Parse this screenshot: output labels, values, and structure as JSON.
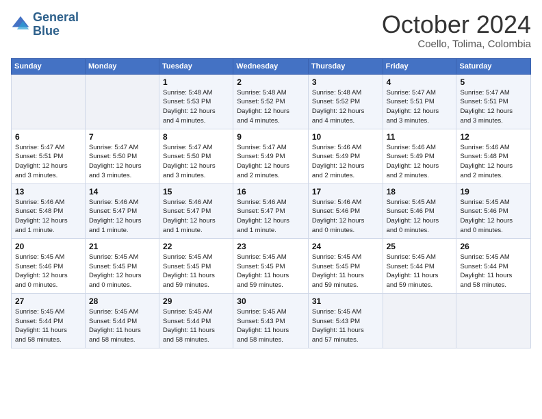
{
  "logo": {
    "line1": "General",
    "line2": "Blue"
  },
  "header": {
    "month": "October 2024",
    "location": "Coello, Tolima, Colombia"
  },
  "days_of_week": [
    "Sunday",
    "Monday",
    "Tuesday",
    "Wednesday",
    "Thursday",
    "Friday",
    "Saturday"
  ],
  "weeks": [
    [
      {
        "day": "",
        "info": ""
      },
      {
        "day": "",
        "info": ""
      },
      {
        "day": "1",
        "info": "Sunrise: 5:48 AM\nSunset: 5:53 PM\nDaylight: 12 hours\nand 4 minutes."
      },
      {
        "day": "2",
        "info": "Sunrise: 5:48 AM\nSunset: 5:52 PM\nDaylight: 12 hours\nand 4 minutes."
      },
      {
        "day": "3",
        "info": "Sunrise: 5:48 AM\nSunset: 5:52 PM\nDaylight: 12 hours\nand 4 minutes."
      },
      {
        "day": "4",
        "info": "Sunrise: 5:47 AM\nSunset: 5:51 PM\nDaylight: 12 hours\nand 3 minutes."
      },
      {
        "day": "5",
        "info": "Sunrise: 5:47 AM\nSunset: 5:51 PM\nDaylight: 12 hours\nand 3 minutes."
      }
    ],
    [
      {
        "day": "6",
        "info": "Sunrise: 5:47 AM\nSunset: 5:51 PM\nDaylight: 12 hours\nand 3 minutes."
      },
      {
        "day": "7",
        "info": "Sunrise: 5:47 AM\nSunset: 5:50 PM\nDaylight: 12 hours\nand 3 minutes."
      },
      {
        "day": "8",
        "info": "Sunrise: 5:47 AM\nSunset: 5:50 PM\nDaylight: 12 hours\nand 3 minutes."
      },
      {
        "day": "9",
        "info": "Sunrise: 5:47 AM\nSunset: 5:49 PM\nDaylight: 12 hours\nand 2 minutes."
      },
      {
        "day": "10",
        "info": "Sunrise: 5:46 AM\nSunset: 5:49 PM\nDaylight: 12 hours\nand 2 minutes."
      },
      {
        "day": "11",
        "info": "Sunrise: 5:46 AM\nSunset: 5:49 PM\nDaylight: 12 hours\nand 2 minutes."
      },
      {
        "day": "12",
        "info": "Sunrise: 5:46 AM\nSunset: 5:48 PM\nDaylight: 12 hours\nand 2 minutes."
      }
    ],
    [
      {
        "day": "13",
        "info": "Sunrise: 5:46 AM\nSunset: 5:48 PM\nDaylight: 12 hours\nand 1 minute."
      },
      {
        "day": "14",
        "info": "Sunrise: 5:46 AM\nSunset: 5:47 PM\nDaylight: 12 hours\nand 1 minute."
      },
      {
        "day": "15",
        "info": "Sunrise: 5:46 AM\nSunset: 5:47 PM\nDaylight: 12 hours\nand 1 minute."
      },
      {
        "day": "16",
        "info": "Sunrise: 5:46 AM\nSunset: 5:47 PM\nDaylight: 12 hours\nand 1 minute."
      },
      {
        "day": "17",
        "info": "Sunrise: 5:46 AM\nSunset: 5:46 PM\nDaylight: 12 hours\nand 0 minutes."
      },
      {
        "day": "18",
        "info": "Sunrise: 5:45 AM\nSunset: 5:46 PM\nDaylight: 12 hours\nand 0 minutes."
      },
      {
        "day": "19",
        "info": "Sunrise: 5:45 AM\nSunset: 5:46 PM\nDaylight: 12 hours\nand 0 minutes."
      }
    ],
    [
      {
        "day": "20",
        "info": "Sunrise: 5:45 AM\nSunset: 5:46 PM\nDaylight: 12 hours\nand 0 minutes."
      },
      {
        "day": "21",
        "info": "Sunrise: 5:45 AM\nSunset: 5:45 PM\nDaylight: 12 hours\nand 0 minutes."
      },
      {
        "day": "22",
        "info": "Sunrise: 5:45 AM\nSunset: 5:45 PM\nDaylight: 11 hours\nand 59 minutes."
      },
      {
        "day": "23",
        "info": "Sunrise: 5:45 AM\nSunset: 5:45 PM\nDaylight: 11 hours\nand 59 minutes."
      },
      {
        "day": "24",
        "info": "Sunrise: 5:45 AM\nSunset: 5:45 PM\nDaylight: 11 hours\nand 59 minutes."
      },
      {
        "day": "25",
        "info": "Sunrise: 5:45 AM\nSunset: 5:44 PM\nDaylight: 11 hours\nand 59 minutes."
      },
      {
        "day": "26",
        "info": "Sunrise: 5:45 AM\nSunset: 5:44 PM\nDaylight: 11 hours\nand 58 minutes."
      }
    ],
    [
      {
        "day": "27",
        "info": "Sunrise: 5:45 AM\nSunset: 5:44 PM\nDaylight: 11 hours\nand 58 minutes."
      },
      {
        "day": "28",
        "info": "Sunrise: 5:45 AM\nSunset: 5:44 PM\nDaylight: 11 hours\nand 58 minutes."
      },
      {
        "day": "29",
        "info": "Sunrise: 5:45 AM\nSunset: 5:44 PM\nDaylight: 11 hours\nand 58 minutes."
      },
      {
        "day": "30",
        "info": "Sunrise: 5:45 AM\nSunset: 5:43 PM\nDaylight: 11 hours\nand 58 minutes."
      },
      {
        "day": "31",
        "info": "Sunrise: 5:45 AM\nSunset: 5:43 PM\nDaylight: 11 hours\nand 57 minutes."
      },
      {
        "day": "",
        "info": ""
      },
      {
        "day": "",
        "info": ""
      }
    ]
  ]
}
